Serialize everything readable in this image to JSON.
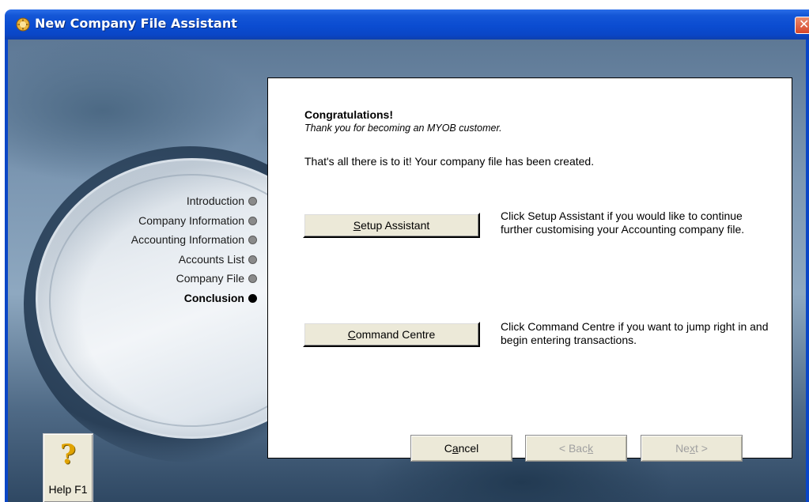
{
  "window": {
    "title": "New Company File Assistant",
    "close_label": "✕"
  },
  "steps": [
    {
      "label": "Introduction",
      "active": false
    },
    {
      "label": "Company Information",
      "active": false
    },
    {
      "label": "Accounting Information",
      "active": false
    },
    {
      "label": "Accounts List",
      "active": false
    },
    {
      "label": "Company File",
      "active": false
    },
    {
      "label": "Conclusion",
      "active": true
    }
  ],
  "panel": {
    "heading": "Congratulations!",
    "subheading": "Thank you for becoming an MYOB customer.",
    "message": "That's all there is to it!  Your company file has been created.",
    "setup_button": {
      "mnemonic": "S",
      "rest": "etup Assistant"
    },
    "setup_description": "Click Setup Assistant if you would like to continue further customising your Accounting company file.",
    "command_button": {
      "mnemonic": "C",
      "rest": "ommand Centre"
    },
    "command_description": "Click Command Centre if you want to jump right in and begin entering transactions."
  },
  "help": {
    "label": "Help F1",
    "icon": "question-mark-icon"
  },
  "nav": {
    "cancel": {
      "before": "C",
      "mnemonic": "a",
      "after": "ncel"
    },
    "back": {
      "before": "< Bac",
      "mnemonic": "k",
      "after": ""
    },
    "next": {
      "before": "Ne",
      "mnemonic": "x",
      "after": "t >"
    }
  },
  "colors": {
    "titlebar": "#0a46c6",
    "panel_bg": "#ffffff",
    "button_face": "#ece9d8",
    "disabled_text": "#a0a0a0"
  }
}
